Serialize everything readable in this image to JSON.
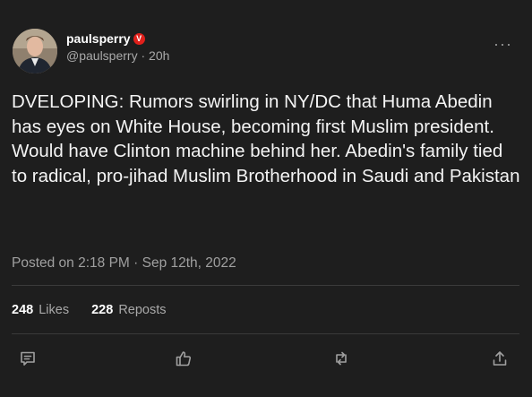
{
  "author": {
    "display_name": "paulsperry",
    "badge_glyph": "V",
    "handle": "@paulsperry",
    "age": "20h"
  },
  "menu": {
    "more_glyph": "···"
  },
  "post": {
    "text": "DVELOPING: Rumors swirling in NY/DC that Huma Abedin has eyes on White House, becoming first Muslim president. Would have Clinton machine behind her. Abedin's family tied to radical, pro-jihad Muslim Brotherhood in Saudi and Pakistan",
    "posted_line": "Posted on 2:18 PM · Sep 12th, 2022"
  },
  "stats": {
    "likes_count": "248",
    "likes_label": "Likes",
    "reposts_count": "228",
    "reposts_label": "Reposts"
  },
  "actions": [
    "comment-icon",
    "like-icon",
    "repost-icon",
    "share-icon"
  ],
  "colors": {
    "background": "#1e1e1e",
    "badge": "#e0201b",
    "muted_text": "#a9a9a9",
    "divider": "#3a3a3a"
  }
}
